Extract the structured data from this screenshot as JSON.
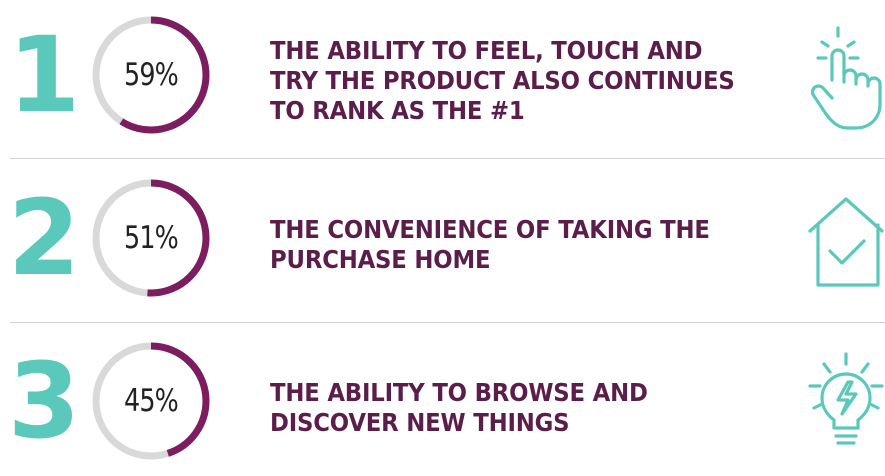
{
  "chart_data": {
    "type": "donut",
    "items": [
      {
        "rank": "1",
        "value": 59,
        "label": "59%",
        "text": "THE ABILITY TO FEEL, TOUCH AND TRY THE PRODUCT ALSO CONTINUES TO RANK AS THE #1",
        "icon": "touch-hand-icon"
      },
      {
        "rank": "2",
        "value": 51,
        "label": "51%",
        "text": "THE CONVENIENCE OF TAKING THE PURCHASE HOME",
        "icon": "home-check-icon"
      },
      {
        "rank": "3",
        "value": 45,
        "label": "45%",
        "text": "THE ABILITY TO BROWSE AND DISCOVER NEW THINGS",
        "icon": "lightbulb-icon"
      }
    ],
    "ylim": [
      0,
      100
    ]
  },
  "colors": {
    "accent_teal": "#5ac9bc",
    "ring_fill": "#7b1d5e",
    "ring_track": "#d9d9d9",
    "text_dark": "#5b1e4a"
  }
}
